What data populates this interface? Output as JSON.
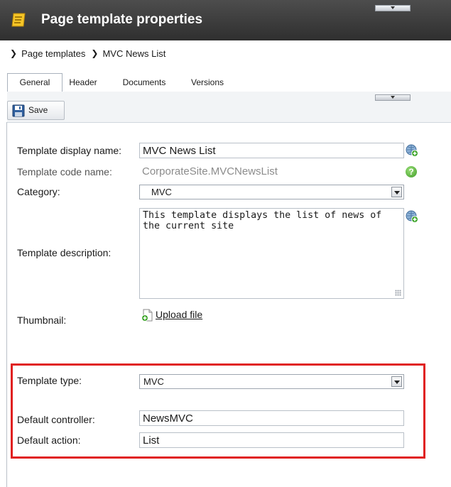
{
  "header": {
    "title": "Page template properties"
  },
  "breadcrumb": {
    "items": [
      "Page templates",
      "MVC News List"
    ]
  },
  "tabs": [
    {
      "label": "General",
      "active": true
    },
    {
      "label": "Header",
      "active": false
    },
    {
      "label": "Documents",
      "active": false
    },
    {
      "label": "Versions",
      "active": false
    }
  ],
  "toolbar": {
    "save_label": "Save"
  },
  "form": {
    "display_name": {
      "label": "Template display name:",
      "value": "MVC News List"
    },
    "code_name": {
      "label": "Template code name:",
      "value": "CorporateSite.MVCNewsList"
    },
    "category": {
      "label": "Category:",
      "value": "MVC"
    },
    "description": {
      "label": "Template description:",
      "value": "This template displays the list of news of the current site"
    },
    "thumbnail": {
      "label": "Thumbnail:",
      "upload_label": "Upload file"
    },
    "template_type": {
      "label": "Template type:",
      "value": "MVC"
    },
    "default_controller": {
      "label": "Default controller:",
      "value": "NewsMVC"
    },
    "default_action": {
      "label": "Default action:",
      "value": "List"
    }
  },
  "icons": {
    "title": "document-properties-icon",
    "save": "floppy-disk-icon",
    "localize": "globe-add-icon",
    "help": "help-icon",
    "upload": "upload-file-icon"
  },
  "colors": {
    "title_bar": "#3c3c3c",
    "highlight": "#e02020"
  }
}
